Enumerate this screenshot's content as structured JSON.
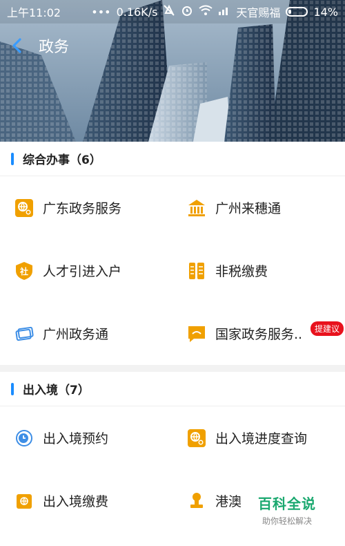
{
  "status_bar": {
    "time": "上午11:02",
    "network_speed": "0.16K/s",
    "carrier": "天官赐福",
    "battery": "14%"
  },
  "header": {
    "title": "政务"
  },
  "sections": [
    {
      "title": "综合办事（6）",
      "items": [
        {
          "label": "广东政务服务",
          "icon": "globe-search-icon",
          "color": "#f0a000"
        },
        {
          "label": "广州来穗通",
          "icon": "bank-icon",
          "color": "#f0a000"
        },
        {
          "label": "人才引进入户",
          "icon": "shield-icon",
          "color": "#f0a000"
        },
        {
          "label": "非税缴费",
          "icon": "tax-icon",
          "color": "#f0a000"
        },
        {
          "label": "广州政务通",
          "icon": "cards-icon",
          "color": "#3d8ee6"
        },
        {
          "label": "国家政务服务..",
          "icon": "chat-icon",
          "color": "#f0a000",
          "badge": "提建议"
        }
      ]
    },
    {
      "title": "出入境（7）",
      "items": [
        {
          "label": "出入境预约",
          "icon": "clock-globe-icon",
          "color": "#3d8ee6"
        },
        {
          "label": "出入境进度查询",
          "icon": "globe-search-icon",
          "color": "#f0a000"
        },
        {
          "label": "出入境缴费",
          "icon": "wallet-icon",
          "color": "#f0a000"
        },
        {
          "label": "港澳",
          "icon": "stamp-icon",
          "color": "#f0a000"
        }
      ]
    }
  ],
  "watermark": {
    "main": "百科全说",
    "sub": "助你轻松解决"
  }
}
